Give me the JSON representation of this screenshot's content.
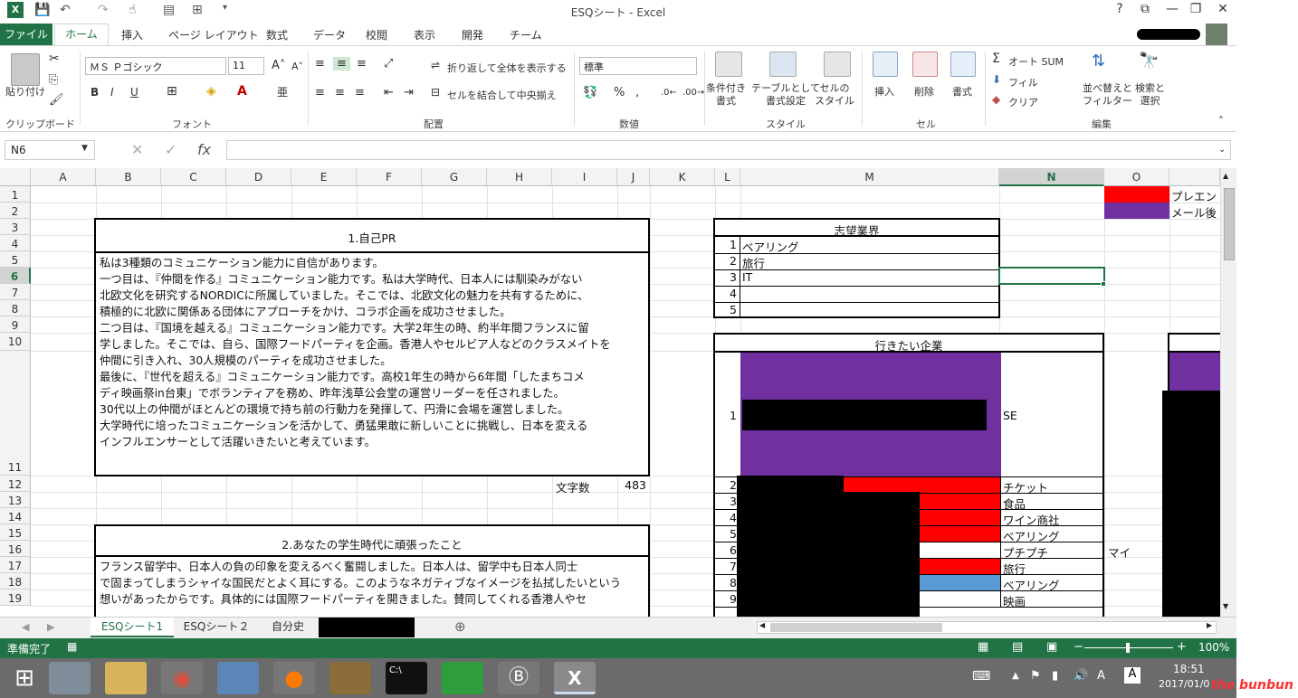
{
  "window": {
    "title": "ESQシート - Excel",
    "help": "?",
    "restore": "⧉",
    "minimize": "—",
    "maximize": "❐",
    "close": "✕"
  },
  "tabs": [
    "ファイル",
    "ホーム",
    "挿入",
    "ページ レイアウト",
    "数式",
    "データ",
    "校閲",
    "表示",
    "開発",
    "チーム"
  ],
  "ribbon": {
    "paste": "貼り付け",
    "groups": {
      "clipboard": "クリップボード",
      "font": "フォント",
      "alignment": "配置",
      "number": "数値",
      "styles": "スタイル",
      "cells": "セル",
      "editing": "編集"
    },
    "font_name": "ＭＳ Ｐゴシック",
    "font_size": "11",
    "bold": "B",
    "italic": "I",
    "underline": "U",
    "wrap_text": "折り返して全体を表示する",
    "merge_center": "セルを結合して中央揃え",
    "number_format": "標準",
    "conditional": "条件付き\n書式",
    "table_format": "テーブルとして\n書式設定",
    "cell_style": "セルの\nスタイル",
    "insert": "挿入",
    "delete": "削除",
    "format": "書式",
    "autosum": "オート SUM",
    "fill": "フィル",
    "clear": "クリア",
    "sort": "並べ替えと\nフィルター",
    "find": "検索と\n選択"
  },
  "formula_bar": {
    "name_box": "N6",
    "fx": "fx",
    "value": ""
  },
  "columns": [
    "A",
    "B",
    "C",
    "D",
    "E",
    "F",
    "G",
    "H",
    "I",
    "J",
    "K",
    "L",
    "M",
    "N",
    "O"
  ],
  "rows": [
    "1",
    "2",
    "3",
    "4",
    "5",
    "6",
    "7",
    "8",
    "9",
    "10",
    "11",
    "12",
    "13",
    "14",
    "15",
    "16",
    "17",
    "18",
    "19"
  ],
  "legend": {
    "item1": "プレエン",
    "item2": "メール後"
  },
  "pr": {
    "heading": "1.自己PR",
    "lines": [
      "  私は3種類のコミュニケーション能力に自信があります。",
      "  一つ目は、『仲間を作る』コミュニケーション能力です。私は大学時代、日本人には馴染みがない",
      "北欧文化を研究するNORDICに所属していました。そこでは、北欧文化の魅力を共有するために、",
      "積極的に北欧に関係ある団体にアプローチをかけ、コラボ企画を成功させました。",
      "  二つ目は、『国境を越える』コミュニケーション能力です。大学2年生の時、約半年間フランスに留",
      "学しました。そこでは、自ら、国際フードパーティを企画。香港人やセルビア人などのクラスメイトを",
      "仲間に引き入れ、30人規模のパーティを成功させました。",
      "  最後に、『世代を超える』コミュニケーション能力です。高校1年生の時から6年間「したまちコメ",
      "ディ映画祭in台東」でボランティアを務め、昨年浅草公会堂の運営リーダーを任されました。",
      "30代以上の仲間がほとんどの環境で持ち前の行動力を発揮して、円滑に会場を運営しました。",
      "  大学時代に培ったコミュニケーションを活かして、勇猛果敢に新しいことに挑戦し、日本を変える",
      "インフルエンサーとして活躍いきたいと考えています。"
    ],
    "char_count_label": "文字数",
    "char_count": "483"
  },
  "student": {
    "heading": "2.あなたの学生時代に頑張ったこと",
    "lines": [
      "  フランス留学中、日本人の負の印象を変えるべく奮闘しました。日本人は、留学中も日本人同士",
      "で固まってしまうシャイな国民だとよく耳にする。このようなネガティブなイメージを払拭したいという",
      "想いがあったからです。具体的には国際フードパーティを開きました。賛同してくれる香港人やセ"
    ]
  },
  "industry": {
    "heading": "志望業界",
    "rows": [
      {
        "n": "1",
        "name": "ベアリング"
      },
      {
        "n": "2",
        "name": "旅行"
      },
      {
        "n": "3",
        "name": "IT"
      },
      {
        "n": "4",
        "name": ""
      },
      {
        "n": "5",
        "name": ""
      }
    ]
  },
  "companies": {
    "heading": "行きたい企業",
    "rows": [
      {
        "n": "1",
        "cat": "SE",
        "color": "#7030a0",
        "extra": ""
      },
      {
        "n": "2",
        "cat": "チケット",
        "color": "#ff0000",
        "extra": ""
      },
      {
        "n": "3",
        "cat": "食品",
        "color": "#ff0000",
        "extra": ""
      },
      {
        "n": "4",
        "cat": "ワイン商社",
        "color": "#ff0000",
        "extra": ""
      },
      {
        "n": "5",
        "cat": "ベアリング",
        "color": "#ff0000",
        "extra": ""
      },
      {
        "n": "6",
        "cat": "プチプチ",
        "color": "#ffffff",
        "extra": "マイ"
      },
      {
        "n": "7",
        "cat": "旅行",
        "color": "#ff0000",
        "extra": ""
      },
      {
        "n": "8",
        "cat": "ベアリング",
        "color": "#5b9bd5",
        "extra": ""
      },
      {
        "n": "9",
        "cat": "映画",
        "color": "#ffffff",
        "extra": ""
      }
    ]
  },
  "sheets": [
    "ESQシート1",
    "ESQシート２",
    "自分史"
  ],
  "status": {
    "ready": "準備完了",
    "zoom": "100%"
  },
  "taskbar": {
    "time": "18:51",
    "date": "2017/01/0"
  },
  "watermark": "the bunbun",
  "colors": {
    "excel_green": "#217346",
    "red": "#ff0000",
    "purple": "#7030a0",
    "blue": "#5b9bd5"
  }
}
